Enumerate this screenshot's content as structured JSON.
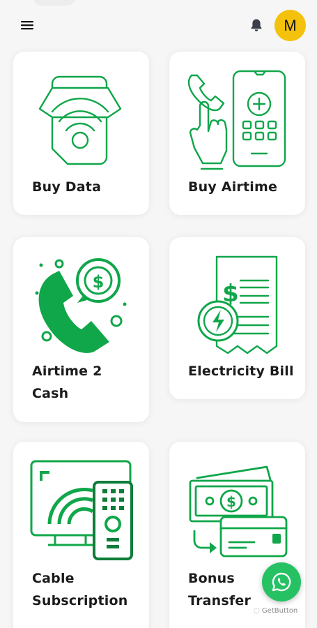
{
  "header": {
    "avatar_initial": "M",
    "icons": {
      "menu": "menu-icon",
      "notifications": "bell-icon"
    }
  },
  "services": [
    {
      "label_lines": [
        "Buy Data"
      ],
      "icon": "wifi-sim-icon"
    },
    {
      "label_lines": [
        "Buy Airtime"
      ],
      "icon": "phone-recharge-icon"
    },
    {
      "label_lines": [
        "Airtime 2",
        "Cash"
      ],
      "icon": "phone-cash-icon"
    },
    {
      "label_lines": [
        "Electricity Bill"
      ],
      "icon": "electric-bill-icon"
    },
    {
      "label_lines": [
        "Cable",
        "Subscription"
      ],
      "icon": "tv-remote-icon"
    },
    {
      "label_lines": [
        "Bonus",
        "Transfer"
      ],
      "icon": "money-transfer-icon"
    }
  ],
  "whatsapp": {
    "icon": "whatsapp-icon",
    "credit": "GetButton"
  },
  "colors": {
    "accent": "#10a64a",
    "avatar": "#f4c20d",
    "whatsapp": "#25c163"
  }
}
